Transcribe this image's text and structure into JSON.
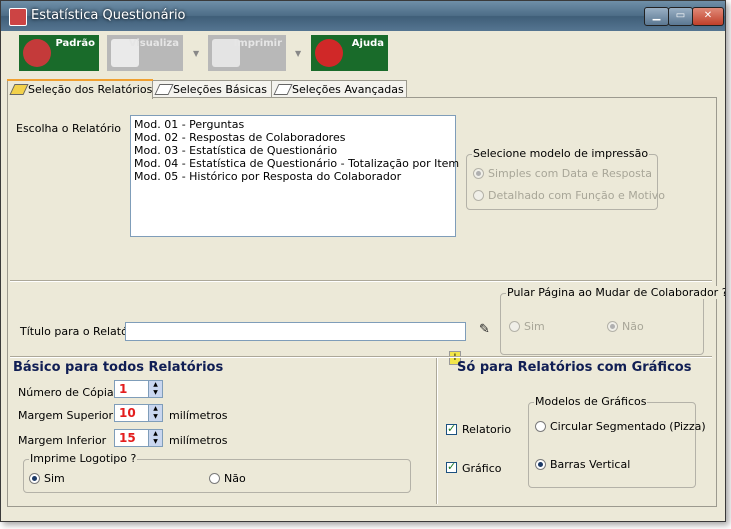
{
  "window": {
    "title": "Estatística Questionário",
    "min_label": "▁",
    "max_label": "▭",
    "close_label": "✕"
  },
  "toolbar": {
    "padrao": "Padrão",
    "visualiza": "Visualiza",
    "imprimir": "Imprimir",
    "ajuda": "Ajuda",
    "dropdown": "▼"
  },
  "tabs": [
    {
      "label": "Seleção dos Relatórios",
      "active": true
    },
    {
      "label": "Seleções Básicas",
      "active": false
    },
    {
      "label": "Seleções Avançadas",
      "active": false
    }
  ],
  "report_select": {
    "label": "Escolha o Relatório",
    "items": [
      "Mod. 01 - Perguntas",
      "Mod. 02 - Respostas de Colaboradores",
      "Mod. 03 - Estatística de Questionário",
      "Mod. 04 - Estatística de Questionário - Totalização por Item",
      "Mod. 05 - Histórico por Resposta do Colaborador"
    ]
  },
  "print_model": {
    "title": "Selecione modelo de impressão",
    "options": [
      "Simples com Data e Resposta",
      "Detalhado com Função e Motivo"
    ],
    "selected": 0
  },
  "title_field": {
    "label": "Título para o Relatório",
    "value": ""
  },
  "page_break": {
    "title": "Pular Página ao Mudar de Colaborador ?",
    "yes": "Sim",
    "no": "Não"
  },
  "basic": {
    "title": "Básico para todos Relatórios",
    "copies_label": "Número de Cópias",
    "copies": "1",
    "top_margin_label": "Margem Superior",
    "top_margin": "10",
    "bottom_margin_label": "Margem Inferior",
    "bottom_margin": "15",
    "unit": "milímetros",
    "logo_title": "Imprime Logotipo ?",
    "logo_yes": "Sim",
    "logo_no": "Não"
  },
  "charts": {
    "title": "Só para Relatórios com Gráficos",
    "relatorio_label": "Relatorio",
    "grafico_label": "Gráfico",
    "models_title": "Modelos de Gráficos",
    "pie_label": "Circular Segmentado (Pizza)",
    "bar_label": "Barras Vertical"
  }
}
